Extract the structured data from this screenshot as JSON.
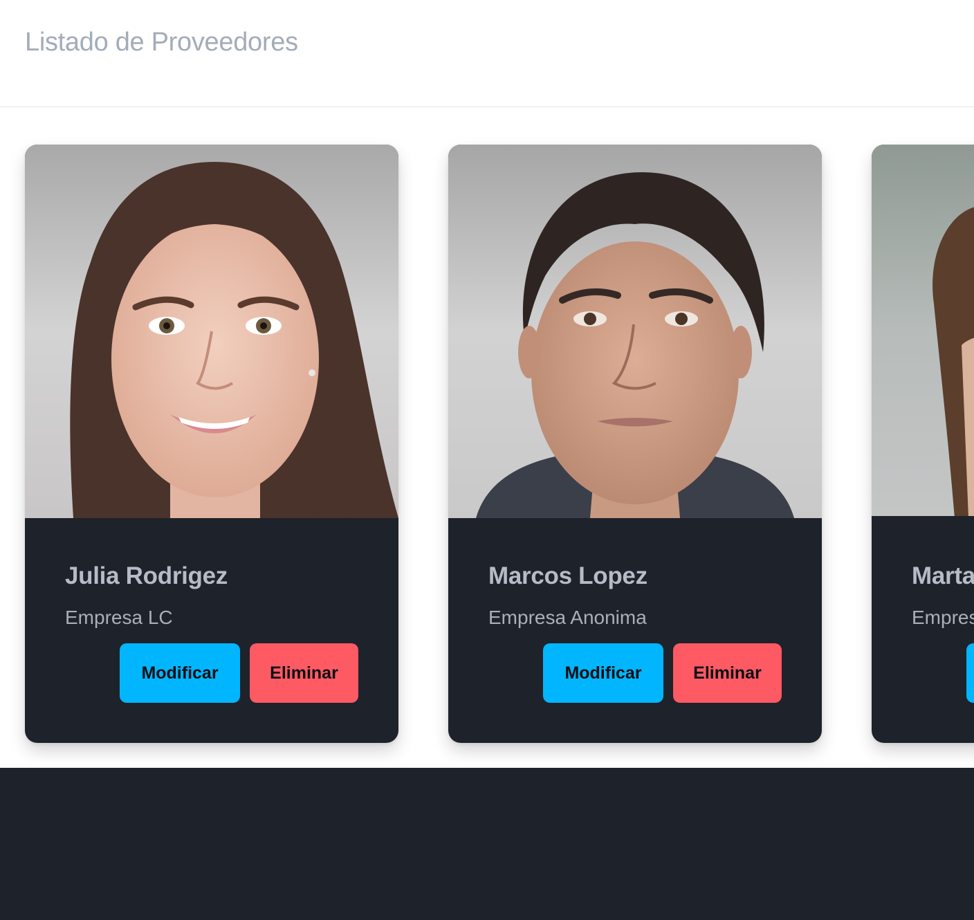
{
  "page": {
    "title": "Listado de Proveedores"
  },
  "colors": {
    "card_bg": "#1e222a",
    "modify_button": "#01b6ff",
    "delete_button": "#fd5a63",
    "title_text": "#a3acb9",
    "footer_bg": "#1e222a"
  },
  "cards": [
    {
      "name": "Julia Rodrigez",
      "company": "Empresa LC",
      "modify_label": "Modificar",
      "delete_label": "Eliminar"
    },
    {
      "name": "Marcos Lopez",
      "company": "Empresa Anonima",
      "modify_label": "Modificar",
      "delete_label": "Eliminar"
    },
    {
      "name": "Marta",
      "company": "Empres",
      "modify_label": "",
      "delete_label": ""
    }
  ]
}
